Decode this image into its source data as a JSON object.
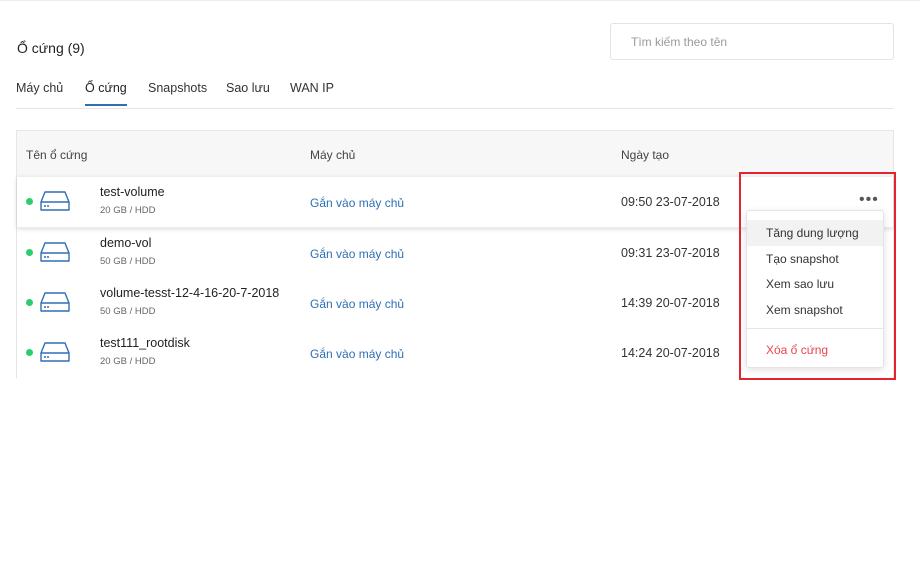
{
  "page": {
    "title": "Ổ cứng (9)"
  },
  "search": {
    "placeholder": "Tìm kiếm theo tên"
  },
  "tabs": [
    {
      "label": "Máy chủ",
      "active": false
    },
    {
      "label": "Ổ cứng",
      "active": true
    },
    {
      "label": "Snapshots",
      "active": false
    },
    {
      "label": "Sao lưu",
      "active": false
    },
    {
      "label": "WAN IP",
      "active": false
    }
  ],
  "table": {
    "columns": [
      "Tên ổ cứng",
      "Máy chủ",
      "Ngày tạo"
    ],
    "rows": [
      {
        "name": "test-volume",
        "size": "20 GB / HDD",
        "server": "Gắn vào máy chủ",
        "date": "09:50 23-07-2018",
        "status_color": "#2ecc71"
      },
      {
        "name": "demo-vol",
        "size": "50 GB / HDD",
        "server": "Gắn vào máy chủ",
        "date": "09:31 23-07-2018",
        "status_color": "#2ecc71"
      },
      {
        "name": "volume-tesst-12-4-16-20-7-2018",
        "size": "50 GB / HDD",
        "server": "Gắn vào máy chủ",
        "date": "14:39 20-07-2018",
        "status_color": "#2ecc71"
      },
      {
        "name": "test111_rootdisk",
        "size": "20 GB / HDD",
        "server": "Gắn vào máy chủ",
        "date": "14:24 20-07-2018",
        "status_color": "#2ecc71"
      }
    ]
  },
  "more_icon": "more-horizontal-icon",
  "menu": {
    "items": [
      "Tăng dung lượng",
      "Tạo snapshot",
      "Xem sao lưu",
      "Xem snapshot"
    ],
    "danger_item": "Xóa ổ cứng"
  },
  "colors": {
    "accent": "#2f6fb5",
    "status_active": "#2ecc71",
    "danger": "#e8454f",
    "highlight_box": "#e5232f"
  }
}
